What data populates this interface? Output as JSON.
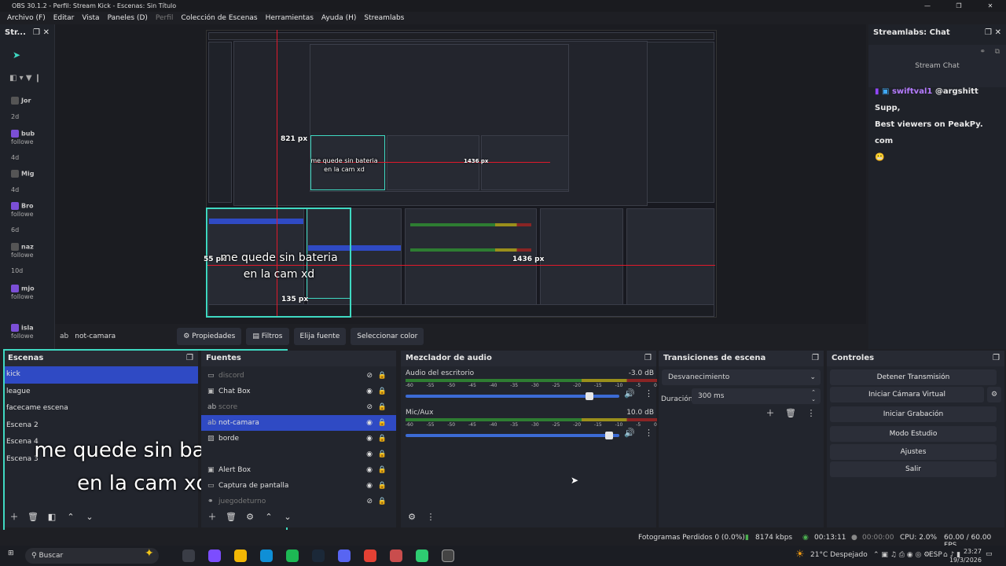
{
  "window": {
    "title": "OBS 30.1.2 - Perfil: Stream Kick - Escenas: Sin Título",
    "controls": [
      "—",
      "❐",
      "✕"
    ]
  },
  "menu": [
    "Archivo (F)",
    "Editar",
    "Vista",
    "Paneles (D)",
    "Perfil",
    "Colección de Escenas",
    "Herramientas",
    "Ayuda (H)",
    "Streamlabs"
  ],
  "left_feed": {
    "header": "Str...",
    "items": [
      {
        "name": "Jor",
        "time": "2d"
      },
      {
        "name": "bub",
        "sub": "followe",
        "time": "4d"
      },
      {
        "name": "Mig",
        "time": "4d"
      },
      {
        "name": "Bro",
        "sub": "followe",
        "time": "6d"
      },
      {
        "name": "naz",
        "sub": "followe",
        "time": "10d"
      },
      {
        "name": "mjo",
        "sub": "followe",
        "time": ""
      },
      {
        "name": "isla",
        "sub": "followe",
        "time": ""
      }
    ]
  },
  "preview": {
    "dims": {
      "top": "821 px",
      "left": "55 px",
      "right": "1436 px",
      "bottom": "135 px",
      "inner_right": "1436 px"
    },
    "overlay_text_line1": "me quede sin bateria",
    "overlay_text_line2": "en la cam xd"
  },
  "context_bar": {
    "source_name": "not-camara",
    "properties": "Propiedades",
    "filters": "Filtros",
    "select_source": "Elija fuente",
    "select_color": "Seleccionar color"
  },
  "scenes": {
    "title": "Escenas",
    "items": [
      {
        "label": "kick",
        "selected": true
      },
      {
        "label": "league",
        "selected": false
      },
      {
        "label": "facecame escena",
        "selected": false
      },
      {
        "label": "Escena 2",
        "selected": false
      },
      {
        "label": "Escena 4",
        "selected": false
      },
      {
        "label": "Escena 3",
        "selected": false
      }
    ]
  },
  "sources": {
    "title": "Fuentes",
    "items": [
      {
        "label": "discord",
        "icon": "window-icon",
        "visible": false
      },
      {
        "label": "Chat Box",
        "icon": "browser-icon",
        "visible": true
      },
      {
        "label": "score",
        "icon": "text-icon",
        "visible": false
      },
      {
        "label": "not-camara",
        "icon": "text-icon",
        "visible": true,
        "selected": true
      },
      {
        "label": "borde",
        "icon": "image-icon",
        "visible": true
      },
      {
        "label": "",
        "icon": "",
        "visible": true
      },
      {
        "label": "Alert Box",
        "icon": "browser-icon",
        "visible": true
      },
      {
        "label": "Captura de pantalla",
        "icon": "monitor-icon",
        "visible": true
      },
      {
        "label": "juegodeturno",
        "icon": "link-icon",
        "visible": false
      }
    ]
  },
  "mixer": {
    "title": "Mezclador de audio",
    "channels": [
      {
        "name": "Audio del escritorio",
        "db": "-3.0 dB",
        "level": 0.88
      },
      {
        "name": "Mic/Aux",
        "db": "10.0 dB",
        "level": 0.97
      }
    ],
    "scale": [
      "-60",
      "-55",
      "-50",
      "-45",
      "-40",
      "-35",
      "-30",
      "-25",
      "-20",
      "-15",
      "-10",
      "-5",
      "0"
    ]
  },
  "transitions": {
    "title": "Transiciones de escena",
    "current": "Desvanecimiento",
    "duration_label": "Duración",
    "duration_value": "300 ms"
  },
  "controls": {
    "title": "Controles",
    "stop_stream": "Detener Transmisión",
    "virtual_cam": "Iniciar Cámara Virtual",
    "start_recording": "Iniciar Grabación",
    "studio_mode": "Modo Estudio",
    "settings": "Ajustes",
    "exit": "Salir"
  },
  "right_chat": {
    "title": "Streamlabs: Chat",
    "header": "Stream Chat",
    "user": "swiftval1",
    "message_line1": "@argshitt Supp,",
    "message_line2": "Best viewers on PeakPy. com",
    "emote": "😬"
  },
  "status": {
    "dropped_frames": "Fotogramas Perdidos 0 (0.0%)",
    "bitrate": "8174 kbps",
    "stream_time": "00:13:11",
    "rec_time": "00:00:00",
    "cpu": "CPU: 2.0%",
    "fps": "60.00 / 60.00 FPS"
  },
  "taskbar": {
    "search": "Buscar",
    "weather": "21°C  Despejado",
    "lang": "ESP",
    "time": "23:27",
    "date": "19/3/2026"
  },
  "colors": {
    "accent": "#2f4ac4",
    "highlight": "#3fd9c2",
    "guide_red": "#e0192b"
  }
}
